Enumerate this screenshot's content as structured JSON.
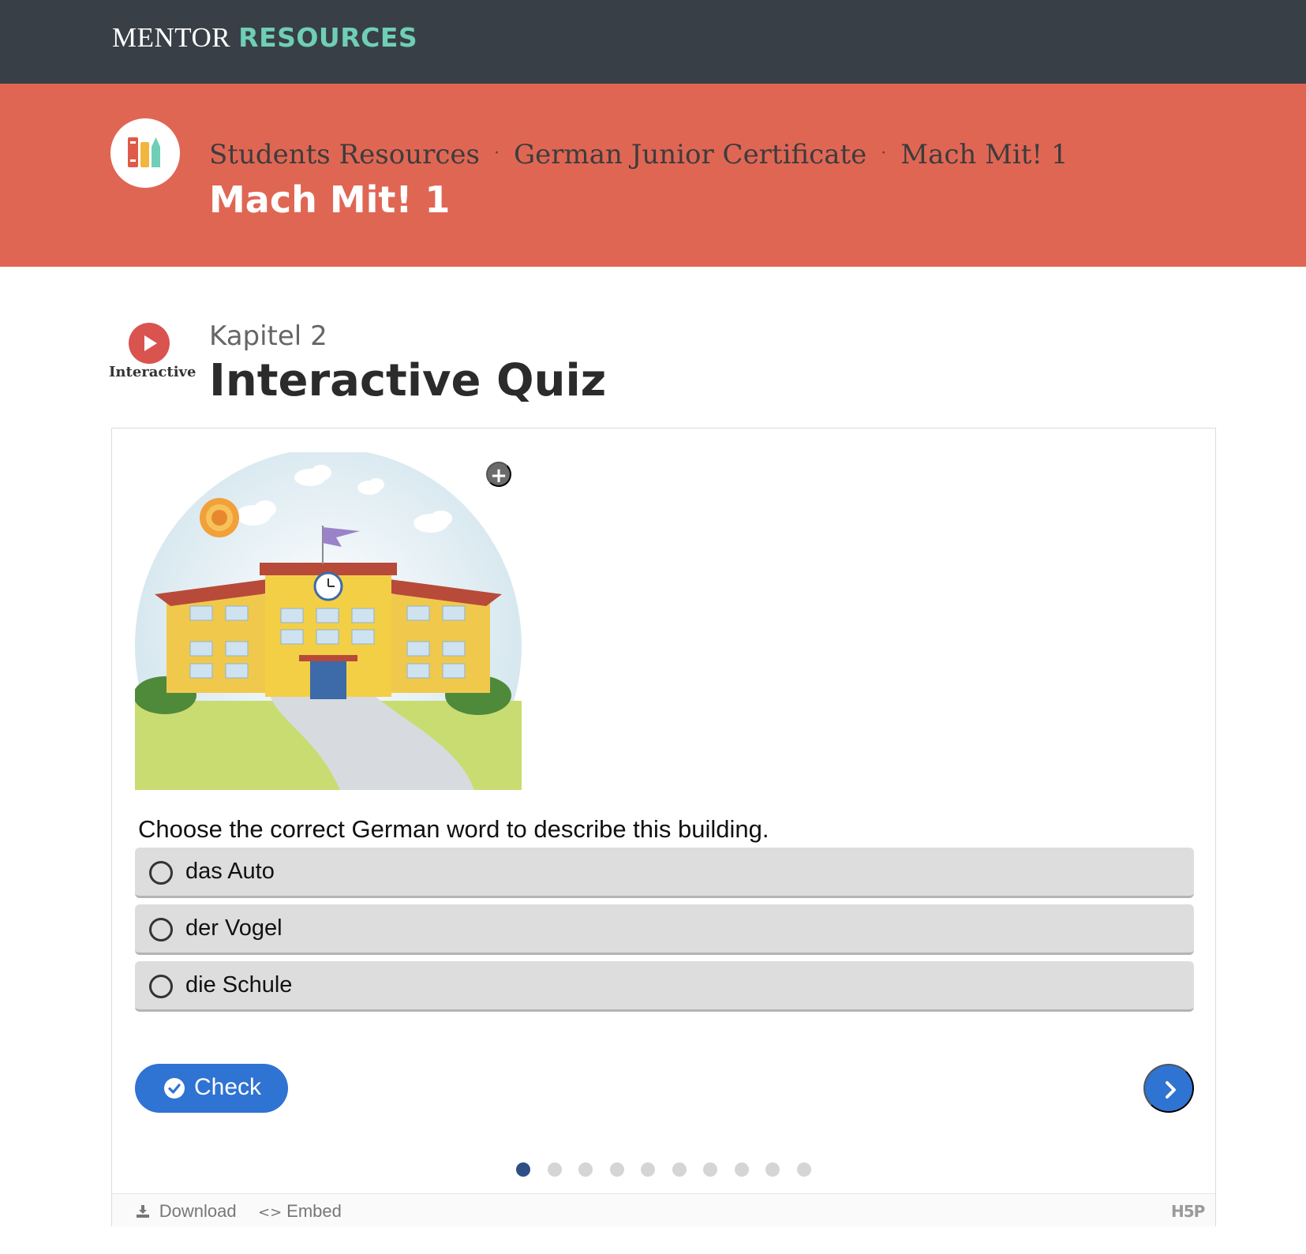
{
  "brand": {
    "part1": "MENTOR",
    "part2": "RESOURCES"
  },
  "breadcrumb": {
    "items": [
      "Students Resources",
      "German Junior Certificate",
      "Mach Mit! 1"
    ],
    "separator": "·"
  },
  "hero": {
    "title": "Mach Mit! 1"
  },
  "activity": {
    "type_label": "Interactive",
    "chapter": "Kapitel 2",
    "title": "Interactive Quiz"
  },
  "quiz": {
    "question": "Choose the correct German word to describe this building.",
    "answers": [
      "das Auto",
      "der Vogel",
      "die Schule"
    ],
    "check_label": "Check",
    "zoom_glyph": "+",
    "progress": {
      "total": 10,
      "current": 1
    }
  },
  "footer": {
    "download_label": "Download",
    "embed_label": "Embed",
    "embed_glyph": "<>",
    "logo_text": "H5P"
  },
  "colors": {
    "topbar": "#383f47",
    "brand_accent": "#6fcfb6",
    "hero": "#e06654",
    "primary_button": "#2f73d3",
    "answer_bg": "#dddddd",
    "dot_active": "#2e4f85",
    "dot_inactive": "#d5d5d5"
  },
  "icons": {
    "logo": "books-pencil-icon",
    "activity": "play-icon",
    "zoom": "plus-circle-icon",
    "check": "check-circle-icon",
    "next": "chevron-right-icon",
    "download": "download-icon",
    "embed": "code-icon"
  }
}
